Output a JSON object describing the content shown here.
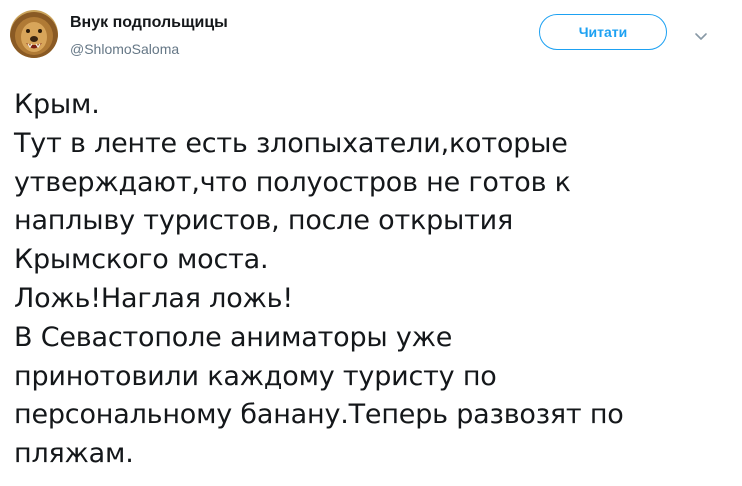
{
  "author": {
    "display_name": "Внук подпольщицы",
    "handle": "@ShlomoSaloma"
  },
  "actions": {
    "follow_label": "Читати"
  },
  "icons": {
    "avatar": "lion-avatar",
    "menu": "chevron-down-icon"
  },
  "colors": {
    "accent": "#1da1f2",
    "text": "#14171a",
    "secondary": "#657786"
  },
  "tweet": {
    "lines": [
      "Крым.",
      "Тут в ленте есть злопыхатели,которые",
      "утверждают,что полуостров не готов к",
      "наплыву туристов, после открытия",
      "Крымского моста.",
      "Ложь!Наглая ложь!",
      "В Севастополе аниматоры уже",
      "принотовили каждому туристу по",
      "персональному банану.Теперь развозят по",
      "пляжам."
    ]
  }
}
